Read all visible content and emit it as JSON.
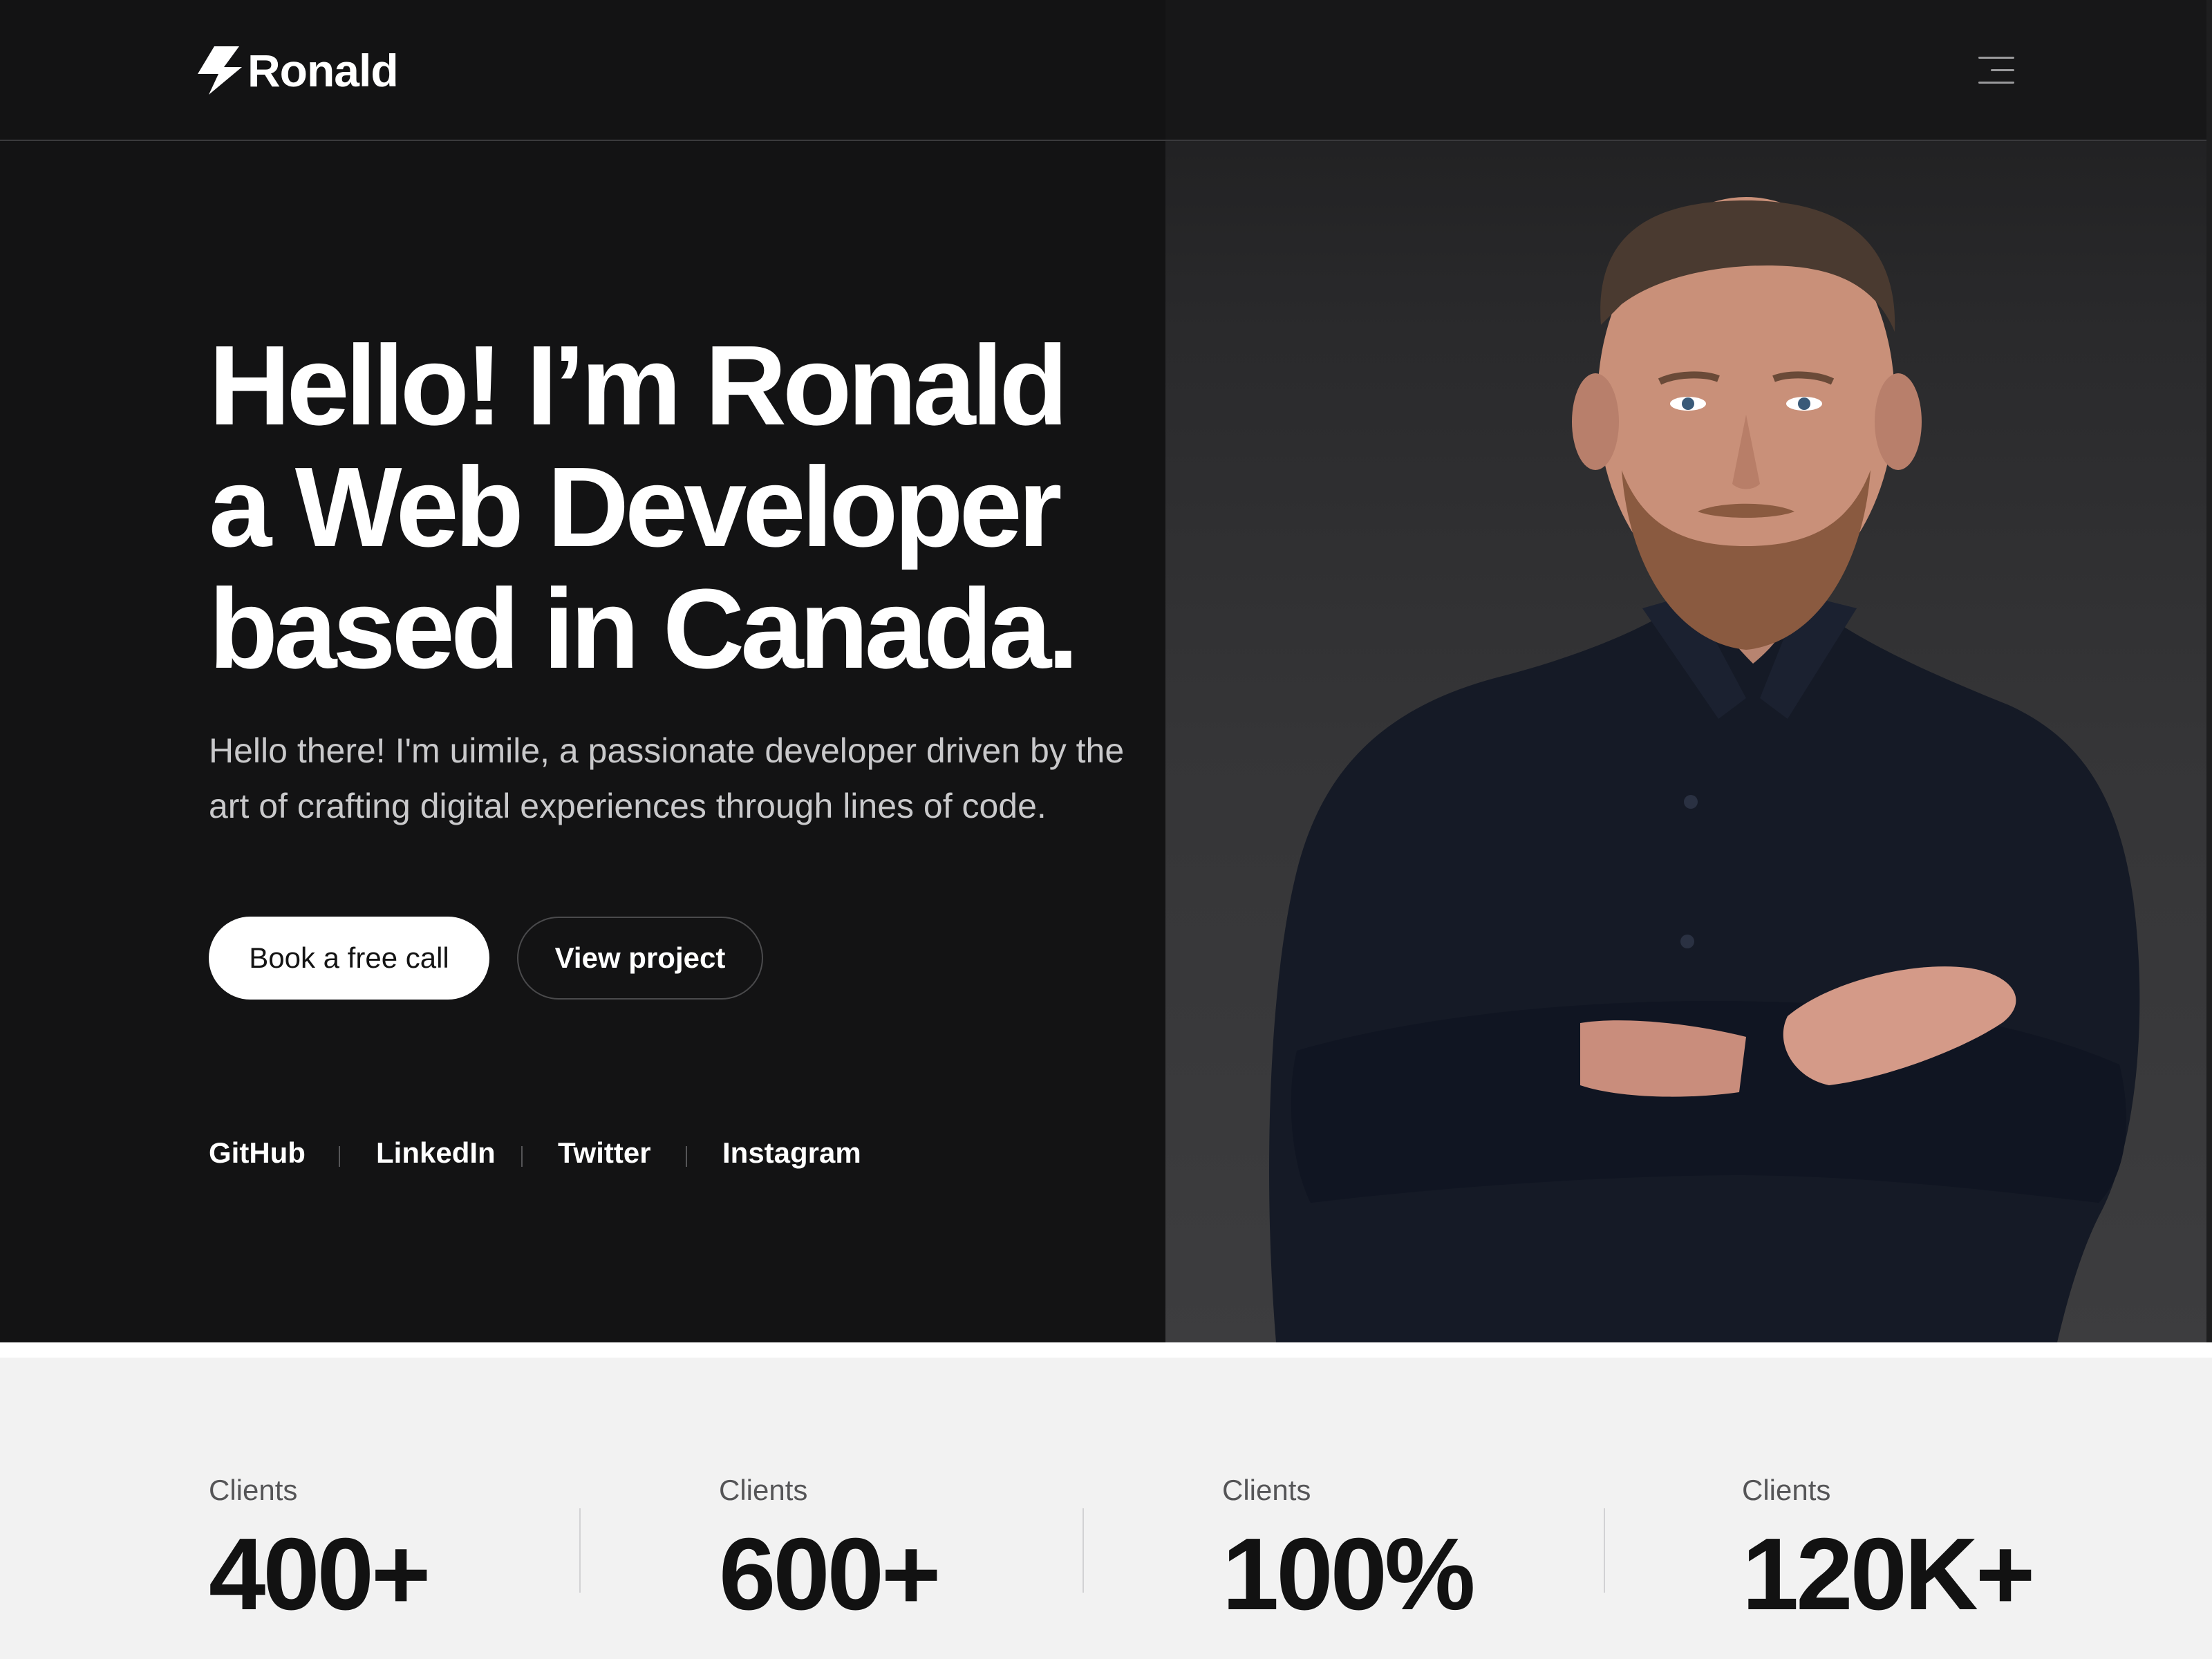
{
  "brand": {
    "name": "Ronald",
    "icon": "lightning-bolt-icon"
  },
  "header": {
    "menu_icon": "hamburger-menu-icon"
  },
  "hero": {
    "headline": [
      "Hello! I’m Ronald",
      "a Web Developer",
      "based in Canada."
    ],
    "intro": "Hello there! I'm uimile, a passionate developer driven by the art of crafting digital experiences through lines of code.",
    "cta_primary": "Book a free call",
    "cta_secondary": "View project",
    "social": [
      "GitHub",
      "LinkedIn",
      "Twitter",
      "Instagram"
    ]
  },
  "stats": [
    {
      "label": "Clients",
      "value": "400+"
    },
    {
      "label": "Clients",
      "value": "600+"
    },
    {
      "label": "Clients",
      "value": "100%"
    },
    {
      "label": "Clients",
      "value": "120K+"
    }
  ],
  "colors": {
    "hero_bg": "#131314",
    "portrait_bg": "#2e2e30",
    "stats_bg": "#f2f2f2",
    "text_light": "#ffffff",
    "text_dark": "#121212"
  }
}
